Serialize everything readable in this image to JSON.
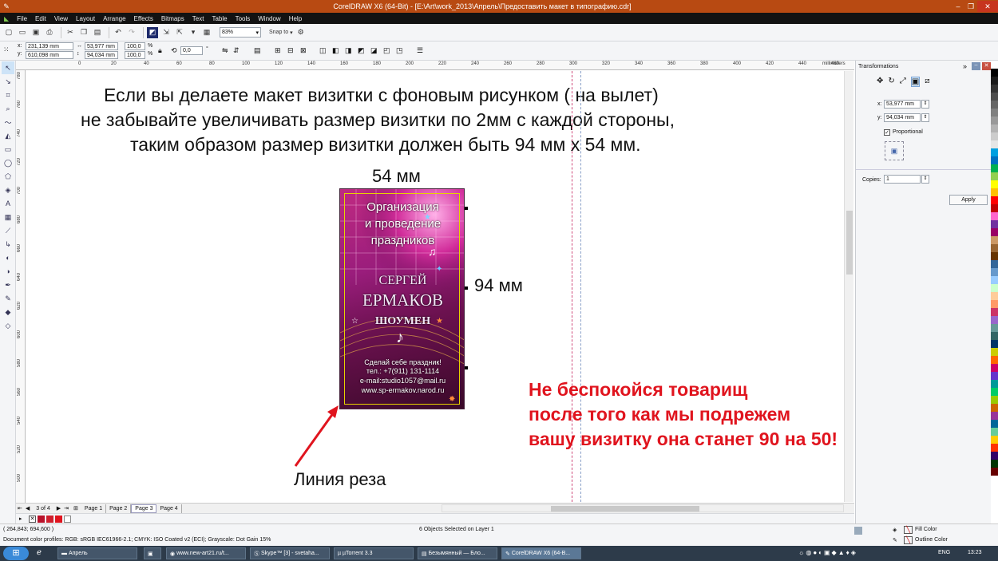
{
  "window": {
    "title": "CorelDRAW X6 (64-Bit) - [E:\\Art\\work_2013\\Апрель\\Предоставить макет в типографию.cdr]"
  },
  "menu": [
    "File",
    "Edit",
    "View",
    "Layout",
    "Arrange",
    "Effects",
    "Bitmaps",
    "Text",
    "Table",
    "Tools",
    "Window",
    "Help"
  ],
  "toolbar": {
    "zoom": "83%",
    "snap_to": "Snap to"
  },
  "propbar": {
    "x": "231,139 mm",
    "y": "610,098 mm",
    "w": "53,977 mm",
    "h": "94,034 mm",
    "scale_w": "100,0",
    "scale_h": "100,0",
    "pct": "%",
    "angle": "0,0",
    "deg": "°"
  },
  "ruler": {
    "h_ticks": [
      "0",
      "20",
      "40",
      "60",
      "80",
      "100",
      "120",
      "140",
      "160",
      "180",
      "200",
      "220",
      "240",
      "260",
      "280",
      "300",
      "320",
      "340",
      "360",
      "380",
      "400",
      "420",
      "440",
      "460"
    ],
    "h_unit": "millimeters",
    "v_ticks": [
      "780",
      "760",
      "740",
      "720",
      "700",
      "680",
      "660",
      "640",
      "620",
      "600",
      "580",
      "560",
      "540",
      "520",
      "500"
    ],
    "v_unit": "millimeters"
  },
  "canvas": {
    "instruction_lines": [
      "Если вы делаете макет визитки с фоновым рисунком ( на вылет)",
      "не забывайте увеличивать размер визитки по 2мм с каждой стороны,",
      "таким образом размер визитки должен быть 94 мм х 54 мм."
    ],
    "width_label": "54 мм",
    "height_label": "94 мм",
    "cut_label": "Линия реза",
    "note_lines": [
      "Не беспокойся товарищ",
      "после того как мы подрежем",
      "вашу визитку она станет 90 на 50!"
    ],
    "note_color": "#e0141e"
  },
  "card": {
    "line1": "Организация",
    "line2": "и проведение",
    "line3": "праздников",
    "first_name": "СЕРГЕЙ",
    "last_name": "ЕРМАКОВ",
    "role": "ШОУМЕН",
    "slogan": "Сделай себе праздник!",
    "phone": "тел.: +7(911) 131-1114",
    "email": "e-mail:studio1057@mail.ru",
    "site": "www.sp-ermakov.narod.ru"
  },
  "docker": {
    "title": "Transformations",
    "x_label": "x:",
    "x_value": "53,977 mm",
    "y_label": "y:",
    "y_value": "94,034 mm",
    "proportional": "Proportional",
    "copies_label": "Copies:",
    "copies_value": "1",
    "apply": "Apply"
  },
  "pages": {
    "counter": "3 of 4",
    "tabs": [
      "Page 1",
      "Page 2",
      "Page 3",
      "Page 4"
    ],
    "active": "Page 3"
  },
  "status": {
    "coords": "( 264,843; 694,600 )",
    "selection": "6 Objects Selected on Layer 1",
    "profiles": "Document color profiles: RGB: sRGB IEC61966-2.1; CMYK: ISO Coated v2 (ECI); Grayscale: Dot Gain 15%",
    "fill": "Fill Color",
    "outline": "Outline Color"
  },
  "taskbar": {
    "items": [
      "Апрель",
      "www.new-art21.ru/t...",
      "Skype™ [3] - svetaha...",
      "µTorrent 3.3",
      "Безымянный — Бло...",
      "CorelDRAW X6 (64-B..."
    ],
    "lang": "ENG",
    "time": "13:23"
  },
  "palette_colors": [
    "#ffffff",
    "#000000",
    "#1a1a1a",
    "#333333",
    "#4d4d4d",
    "#666666",
    "#808080",
    "#999999",
    "#b3b3b3",
    "#cccccc",
    "#e6e6e6",
    "#00a0e0",
    "#0070c0",
    "#00b050",
    "#92d050",
    "#ffff00",
    "#ffc000",
    "#ff0000",
    "#c00000",
    "#ff66cc",
    "#7030a0",
    "#990066",
    "#cc9966",
    "#996633",
    "#663300",
    "#336699",
    "#6699cc",
    "#99ccff",
    "#ccffcc",
    "#ffcc99",
    "#ff9966",
    "#cc3366",
    "#9966cc",
    "#669999",
    "#336666",
    "#003366",
    "#cccc00",
    "#ff6600",
    "#cc0066",
    "#6633cc",
    "#009999",
    "#00cc66",
    "#99cc00",
    "#cc6600",
    "#993399",
    "#006699",
    "#66cc99",
    "#ffcc00",
    "#ff3300",
    "#330066",
    "#003300",
    "#660000"
  ]
}
